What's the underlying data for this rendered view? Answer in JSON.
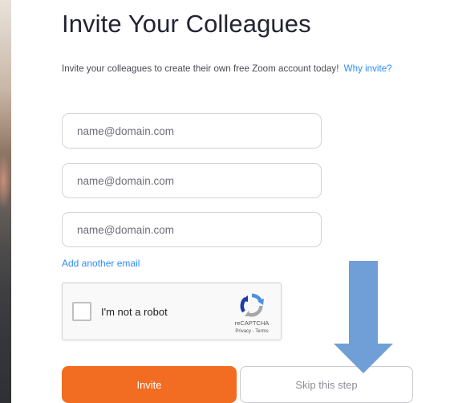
{
  "page": {
    "title": "Invite Your Colleagues",
    "subtitle": "Invite your colleagues to create their own free Zoom account today!",
    "why_invite_link": "Why invite?"
  },
  "email_fields": [
    {
      "placeholder": "name@domain.com",
      "value": ""
    },
    {
      "placeholder": "name@domain.com",
      "value": ""
    },
    {
      "placeholder": "name@domain.com",
      "value": ""
    }
  ],
  "add_email_link": "Add another email",
  "recaptcha": {
    "label": "I'm not a robot",
    "brand": "reCAPTCHA",
    "terms": "Privacy - Terms",
    "checked": false
  },
  "buttons": {
    "invite_label": "Invite",
    "skip_label": "Skip this step"
  },
  "annotation": {
    "arrow_icon": "arrow-down-icon",
    "arrow_color": "#6f9fd6"
  },
  "colors": {
    "primary_orange": "#f26d21",
    "link_blue": "#2d8cff",
    "title_text": "#232333"
  }
}
